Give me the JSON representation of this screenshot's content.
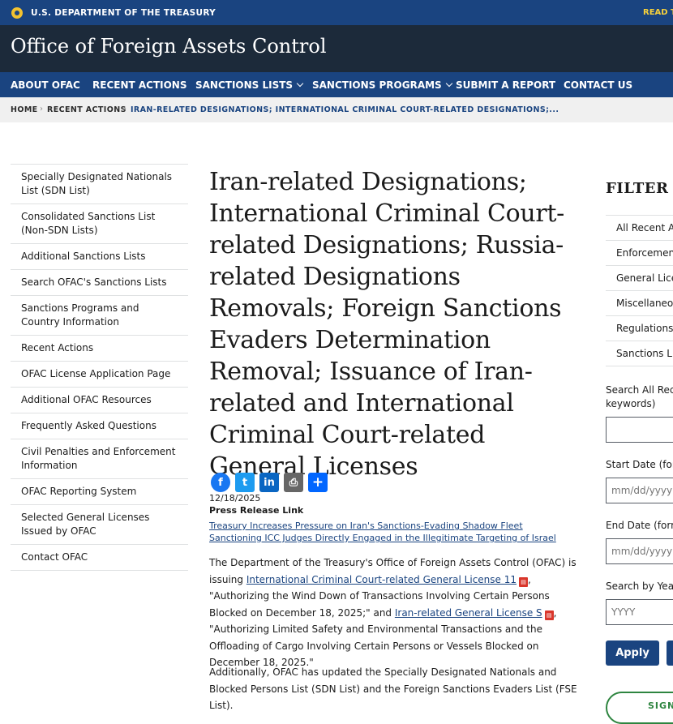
{
  "topbar": {
    "department": "U.S. DEPARTMENT OF THE TREASURY",
    "read_link": "READ T"
  },
  "header": {
    "site_title": "Office of Foreign Assets Control"
  },
  "nav": {
    "items": [
      "ABOUT OFAC",
      "RECENT ACTIONS",
      "SANCTIONS LISTS",
      "SANCTIONS PROGRAMS",
      "SUBMIT A REPORT",
      "CONTACT US"
    ]
  },
  "breadcrumb": {
    "home": "HOME",
    "level2": "RECENT ACTIONS",
    "current": "IRAN-RELATED DESIGNATIONS; INTERNATIONAL CRIMINAL COURT-RELATED DESIGNATIONS;..."
  },
  "sidebar": {
    "items": [
      "Specially Designated Nationals List (SDN List)",
      "Consolidated Sanctions List (Non-SDN Lists)",
      "Additional Sanctions Lists",
      "Search OFAC's Sanctions Lists",
      "Sanctions Programs and Country Information",
      "Recent Actions",
      "OFAC License Application Page",
      "Additional OFAC Resources",
      "Frequently Asked Questions",
      "Civil Penalties and Enforcement Information",
      "OFAC Reporting System",
      "Selected General Licenses Issued by OFAC",
      "Contact OFAC"
    ]
  },
  "article": {
    "title": "Iran-related Designations; International Criminal Court-related Designations; Russia-related Designations Removals; Foreign Sanctions Evaders Determination Removal; Issuance of Iran-related and International Criminal Court-related General Licenses",
    "share_buttons": [
      "Facebook",
      "Twitter",
      "LinkedIn",
      "Print",
      "Share"
    ],
    "date": "12/18/2025",
    "press_release_label": "Press Release Link",
    "press_links": [
      "Treasury Increases Pressure on Iran's Sanctions-Evading Shadow Fleet",
      "Sanctioning ICC Judges Directly Engaged in the Illegitimate Targeting of Israel"
    ],
    "p1_a": "The Department of the Treasury's Office of Foreign Assets Control (OFAC) is issuing ",
    "p1_link1": "International Criminal Court-related General License 11",
    "p1_b": ", \"Authorizing the Wind Down of Transactions Involving Certain Persons Blocked on December 18, 2025;\" and ",
    "p1_link2": "Iran-related General License S",
    "p1_c": ", \"Authorizing Limited Safety and Environmental Transactions and the Offloading of Cargo Involving Certain Persons or Vessels Blocked on December 18, 2025.\"",
    "p2": "Additionally, OFAC has updated the Specially Designated Nationals and Blocked Persons List (SDN List) and the Foreign Sanctions Evaders List (FSE List)."
  },
  "filter": {
    "heading": "FILTER R",
    "categories": [
      "All Recent Ac",
      "Enforcement",
      "General Licen",
      "Miscellaneous",
      "Regulations a",
      "Sanctions Lis"
    ],
    "search_label_line1": "Search All Rece",
    "search_label_line2": "keywords)",
    "start_label": "Start Date (form",
    "start_placeholder": "mm/dd/yyyy",
    "end_label": "End Date (forma",
    "end_placeholder": "mm/dd/yyyy",
    "year_label": "Search by Year",
    "year_placeholder": "YYYY",
    "apply_label": "Apply",
    "signup_label": "SIGN"
  },
  "colors": {
    "primary": "#1a4480",
    "header": "#1c2a3a",
    "accent_gold": "#f2c230",
    "signup_green": "#2e8540",
    "pdf_red": "#d9362b"
  }
}
